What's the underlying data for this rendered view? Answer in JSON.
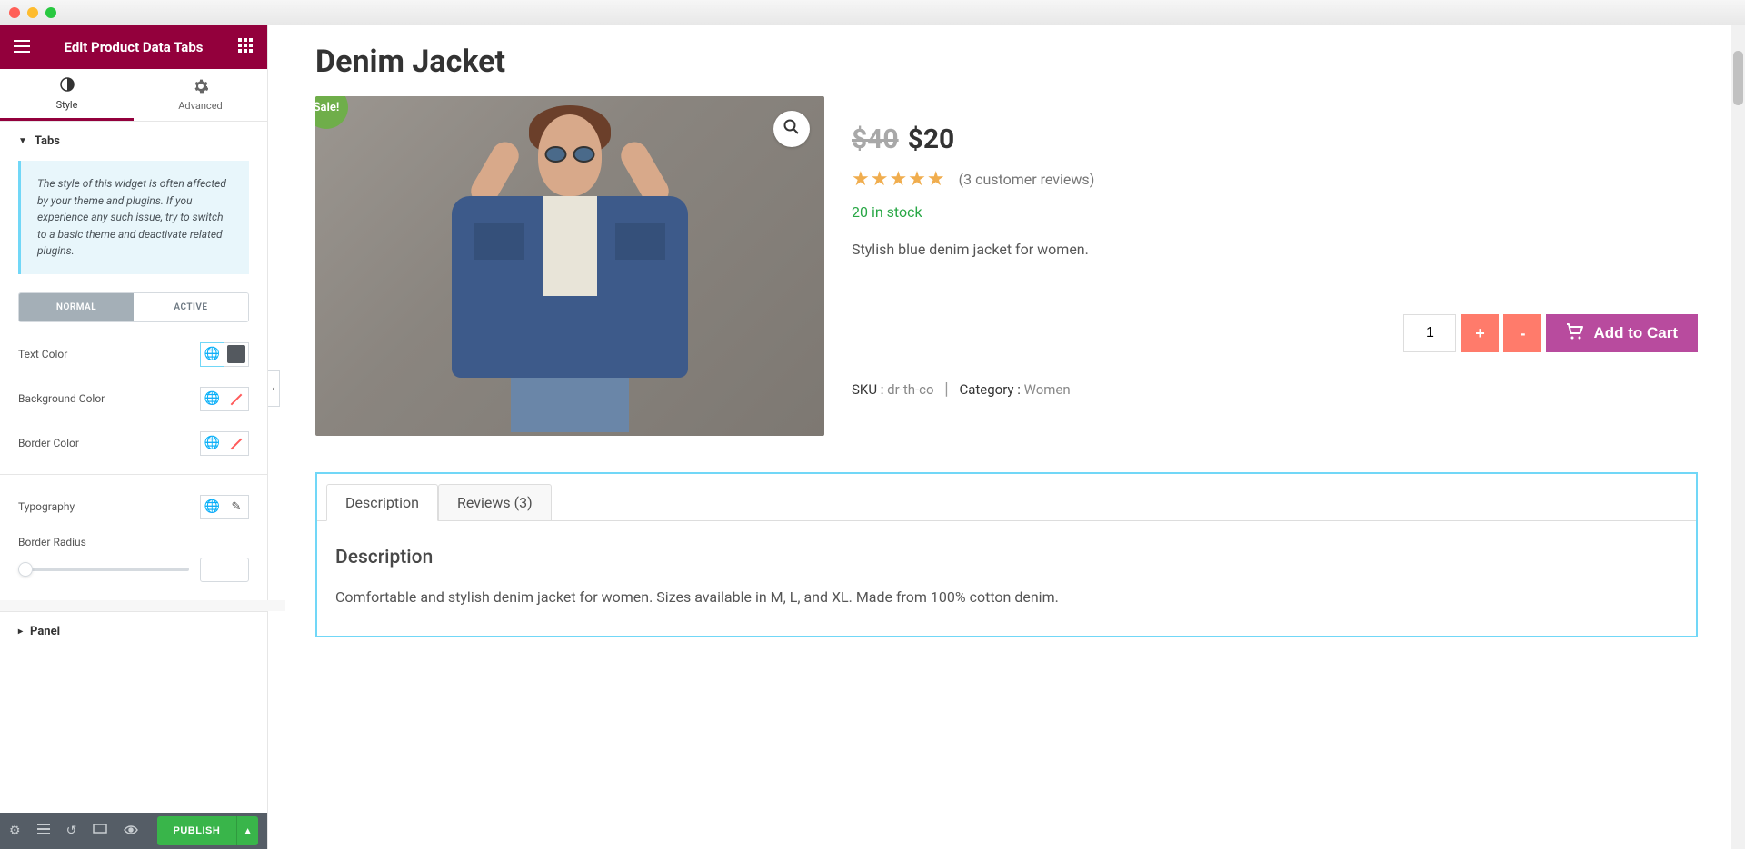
{
  "window": {
    "title": "Edit Product Data Tabs"
  },
  "editor": {
    "tabs": {
      "style": "Style",
      "advanced": "Advanced"
    },
    "sections": {
      "tabs_label": "Tabs",
      "panel_label": "Panel",
      "info_text": "The style of this widget is often affected by your theme and plugins. If you experience any such issue, try to switch to a basic theme and deactivate related plugins.",
      "state_toggle": {
        "normal": "NORMAL",
        "active": "ACTIVE"
      },
      "controls": {
        "text_color": "Text Color",
        "background_color": "Background Color",
        "border_color": "Border Color",
        "typography": "Typography",
        "border_radius": "Border Radius"
      }
    },
    "footer": {
      "publish": "PUBLISH"
    }
  },
  "product": {
    "title": "Denim Jacket",
    "sale_badge": "Sale!",
    "price": {
      "old": "$40",
      "new": "$20"
    },
    "rating": {
      "stars": "★★★★★",
      "reviews_text": "(3 customer reviews)"
    },
    "stock": "20 in stock",
    "short_description": "Stylish blue denim jacket for women.",
    "quantity": "1",
    "buttons": {
      "plus": "+",
      "minus": "-",
      "add_to_cart": "Add to Cart"
    },
    "meta": {
      "sku_label": "SKU :",
      "sku_value": "dr-th-co",
      "category_label": "Category :",
      "category_value": "Women"
    },
    "data_tabs": {
      "description_tab": "Description",
      "reviews_tab": "Reviews (3)",
      "description_heading": "Description",
      "description_body": "Comfortable and stylish denim jacket for women. Sizes available in M, L, and XL. Made from 100% cotton denim."
    }
  }
}
